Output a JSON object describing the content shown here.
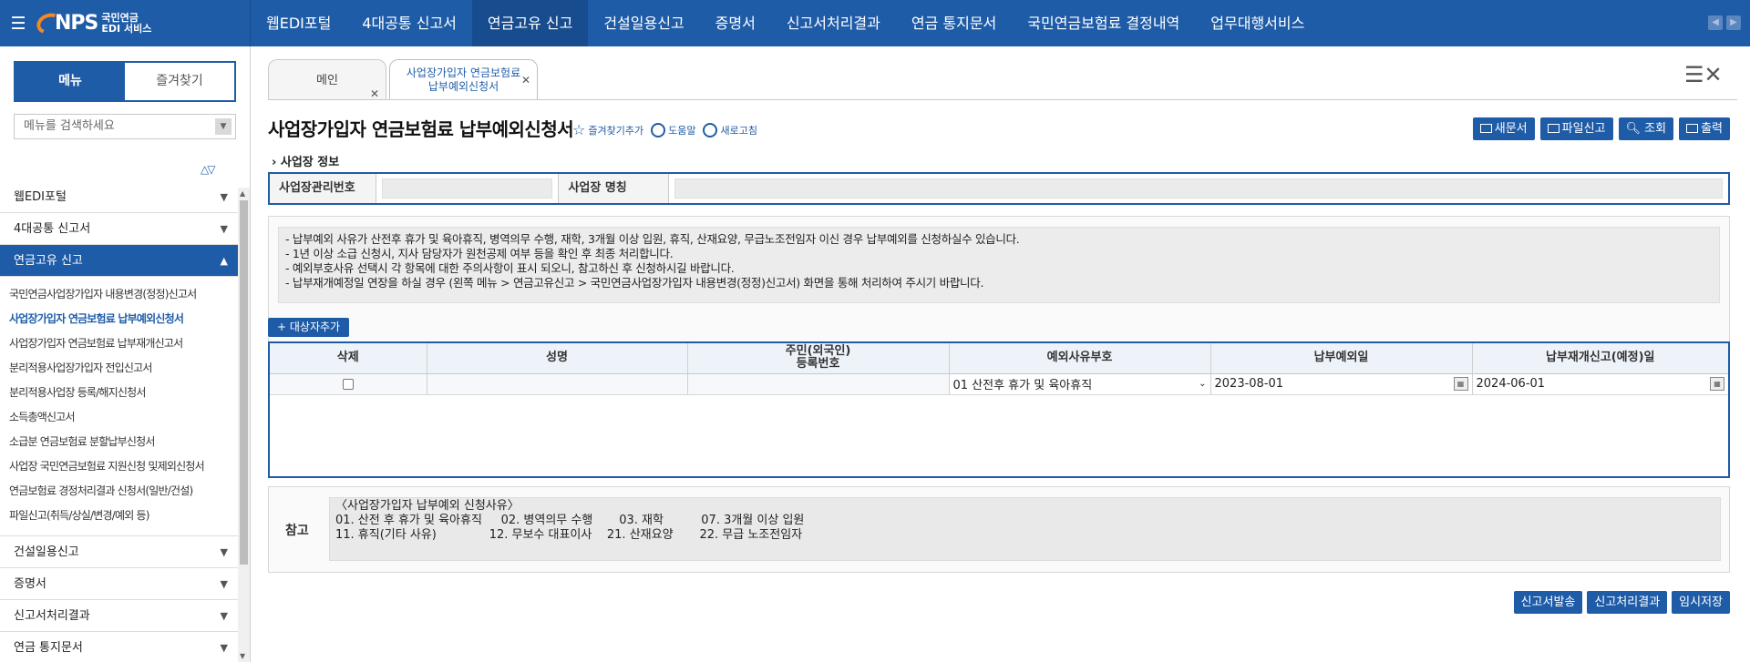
{
  "topbar": {
    "logo_main": "NPS",
    "logo_sub_line1": "국민연금",
    "logo_sub_line2": "EDI 서비스",
    "nav": [
      "웹EDI포털",
      "4대공통 신고서",
      "연금고유 신고",
      "건설일용신고",
      "증명서",
      "신고서처리결과",
      "연금 통지문서",
      "국민연금보험료 결정내역",
      "업무대행서비스"
    ],
    "active_nav_index": 2,
    "accent_color": "#1f5ca8"
  },
  "sidebar": {
    "tab_menu": "메뉴",
    "tab_favorites": "즐겨찾기",
    "search_placeholder": "메뉴를 검색하세요",
    "top_items": [
      "웹EDI포털",
      "4대공통 신고서"
    ],
    "open_item": "연금고유 신고",
    "sub_items": [
      "국민연금사업장가입자 내용변경(정정)신고서",
      "사업장가입자 연금보험료 납부예외신청서",
      "사업장가입자 연금보험료 납부재개신고서",
      "분리적용사업장가입자 전입신고서",
      "분리적용사업장 등록/해지신청서",
      "소득총액신고서",
      "소급분 연금보험료 분할납부신청서",
      "사업장 국민연금보험료 지원신청 및제외신청서",
      "연금보험료 경정처리결과 신청서(일반/건설)",
      "파일신고(취득/상실/변경/예외 등)"
    ],
    "current_sub_index": 1,
    "bottom_items": [
      "건설일용신고",
      "증명서",
      "신고서처리결과",
      "연금 통지문서"
    ]
  },
  "tabs": {
    "main_label": "메인",
    "current_line1": "사업장가입자 연금보험료",
    "current_line2": "납부예외신청서"
  },
  "page": {
    "title": "사업장가입자 연금보험료 납부예외신청서",
    "tool_favorite": "즐겨찾기추가",
    "tool_help": "도움말",
    "tool_refresh": "새로고침",
    "btn_new": "새문서",
    "btn_file": "파일신고",
    "btn_search": "조회",
    "btn_print": "출력"
  },
  "workplace": {
    "section_title": "사업장 정보",
    "label_mgmt_no": "사업장관리번호",
    "label_name": "사업장 명칭",
    "mgmt_no_value": "",
    "name_value": ""
  },
  "notice": {
    "lines": [
      "- 납부예외 사유가 산전후 휴가 및 육아휴직, 병역의무 수행, 재학, 3개월 이상 입원, 휴직, 산재요양, 무급노조전임자 이신 경우 납부예외를 신청하실수 있습니다.",
      "- 1년 이상 소급 신청시, 지사 담당자가 원천공제 여부 등을 확인 후 최종 처리합니다.",
      "- 예외부호사유 선택시 각 항목에 대한 주의사항이 표시 되오니, 참고하신 후 신청하시길 바랍니다.",
      "- 납부재개예정일 연장을 하실 경우 (왼쪽 메뉴 > 연금고유신고 > 국민연금사업장가입자 내용변경(정정)신고서) 화면을 통해 처리하여 주시기 바랍니다."
    ]
  },
  "grid": {
    "add_button": "+ 대상자추가",
    "headers": [
      "삭제",
      "성명",
      "주민(외국인)",
      "등록번호",
      "예외사유부호",
      "납부예외일",
      "납부재개신고(예정)일"
    ],
    "rows": [
      {
        "name": "",
        "rrn": "",
        "reason": "01 산전후 휴가 및 육아휴직",
        "exempt_date": "2023-08-01",
        "resume_date": "2024-06-01"
      }
    ]
  },
  "reference": {
    "label": "참고",
    "heading": "〈사업장가입자 납부예외 신청사유〉",
    "line1": "01. 산전 후 휴가 및 육아휴직     02. 병역의무 수행       03. 재학          07. 3개월 이상 입원",
    "line2": "11. 휴직(기타 사유)              12. 무보수 대표이사    21. 산재요양       22. 무급 노조전임자"
  },
  "bottom_buttons": {
    "submit": "신고서발송",
    "result": "신고처리결과",
    "temp_save": "임시저장"
  }
}
